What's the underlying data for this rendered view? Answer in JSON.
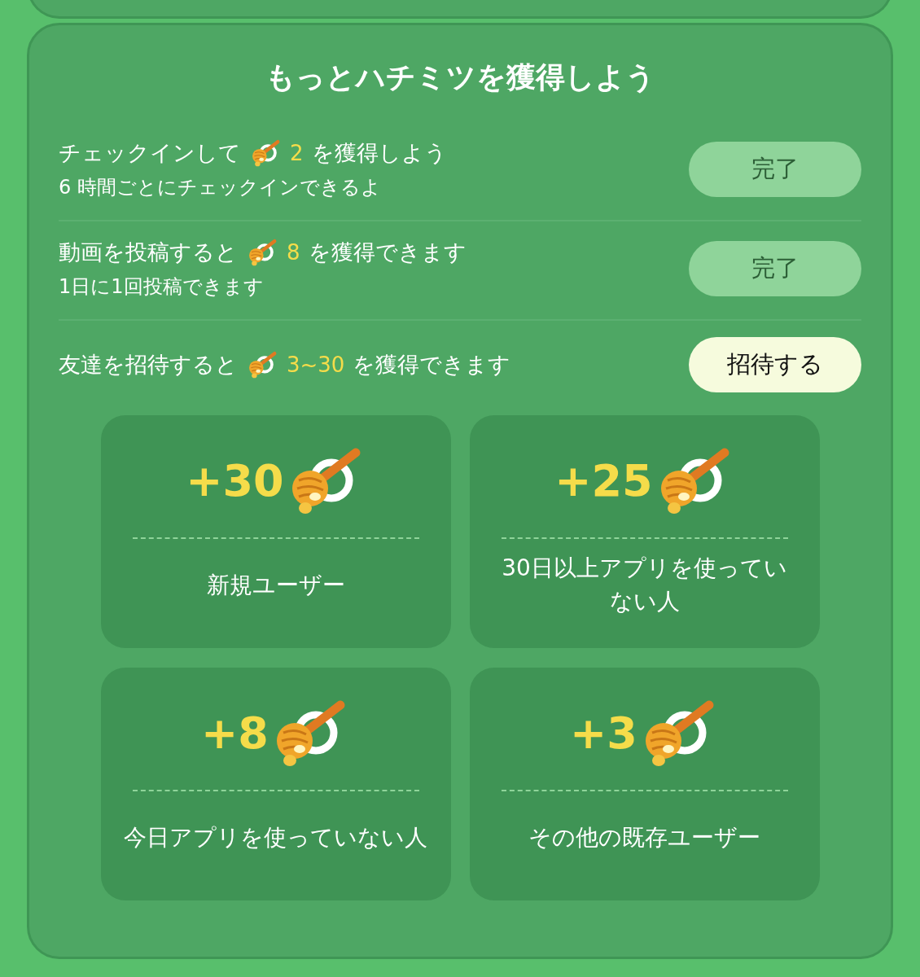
{
  "title": "もっとハチミツを獲得しよう",
  "tasks": [
    {
      "before": "チェックインして",
      "amount": "2",
      "after": "を獲得しよう",
      "note": "6 時間ごとにチェックインできるよ",
      "button": {
        "label": "完了",
        "kind": "done"
      }
    },
    {
      "before": "動画を投稿すると",
      "amount": "8",
      "after": "を獲得できます",
      "note": "1日に1回投稿できます",
      "button": {
        "label": "完了",
        "kind": "done"
      }
    },
    {
      "before": "友達を招待すると",
      "amount": "3~30",
      "after": "を獲得できます",
      "button": {
        "label": "招待する",
        "kind": "invite"
      }
    }
  ],
  "rewards": [
    {
      "amount": "+30",
      "label": "新規ユーザー"
    },
    {
      "amount": "+25",
      "label": "30日以上アプリを使っていない人"
    },
    {
      "amount": "+8",
      "label": "今日アプリを使っていない人"
    },
    {
      "amount": "+3",
      "label": "その他の既存ユーザー"
    }
  ]
}
